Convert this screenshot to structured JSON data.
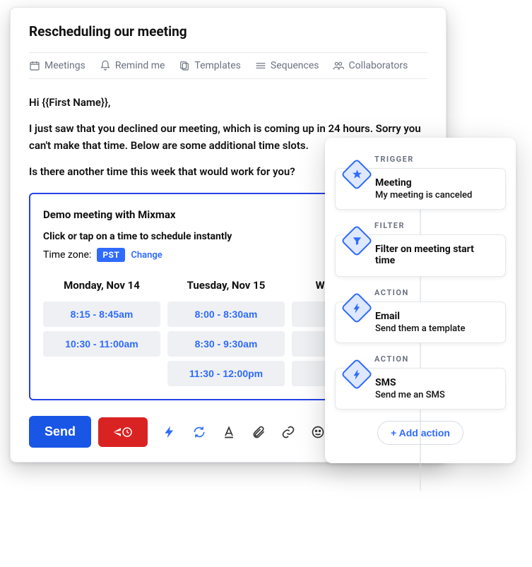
{
  "composer": {
    "subject": "Rescheduling our meeting",
    "toolbar": {
      "meetings": "Meetings",
      "remind": "Remind me",
      "templates": "Templates",
      "sequences": "Sequences",
      "collaborators": "Collaborators"
    },
    "body": {
      "greeting": "Hi {{First Name}},",
      "p1": "I just saw that you declined our meeting, which is coming up in 24 hours. Sorry you can't make that time. Below are some additional time slots.",
      "p2": "Is there another time this week that would work for you?"
    }
  },
  "scheduler": {
    "title": "Demo meeting with Mixmax",
    "instruction": "Click or tap on a time to schedule instantly",
    "tz_label": "Time zone:",
    "tz_value": "PST",
    "tz_change": "Change",
    "columns": [
      {
        "heading": "Monday, Nov 14",
        "slots": [
          "8:15 - 8:45am",
          "10:30 - 11:00am"
        ]
      },
      {
        "heading": "Tuesday, Nov 15",
        "slots": [
          "8:00 - 8:30am",
          "8:30 - 9:30am",
          "11:30 - 12:00pm"
        ]
      },
      {
        "heading": "W",
        "slots": [
          "",
          "",
          ""
        ]
      }
    ]
  },
  "actions": {
    "send": "Send"
  },
  "workflow": {
    "steps": [
      {
        "kind": "TRIGGER",
        "title": "Meeting",
        "desc": "My meeting is canceled",
        "icon": "star"
      },
      {
        "kind": "FILTER",
        "title": "Filter on meeting start time",
        "desc": "",
        "icon": "funnel"
      },
      {
        "kind": "ACTION",
        "title": "Email",
        "desc": "Send them a template",
        "icon": "bolt"
      },
      {
        "kind": "ACTION",
        "title": "SMS",
        "desc": "Send me an SMS",
        "icon": "bolt"
      }
    ],
    "add_action": "+  Add action"
  }
}
